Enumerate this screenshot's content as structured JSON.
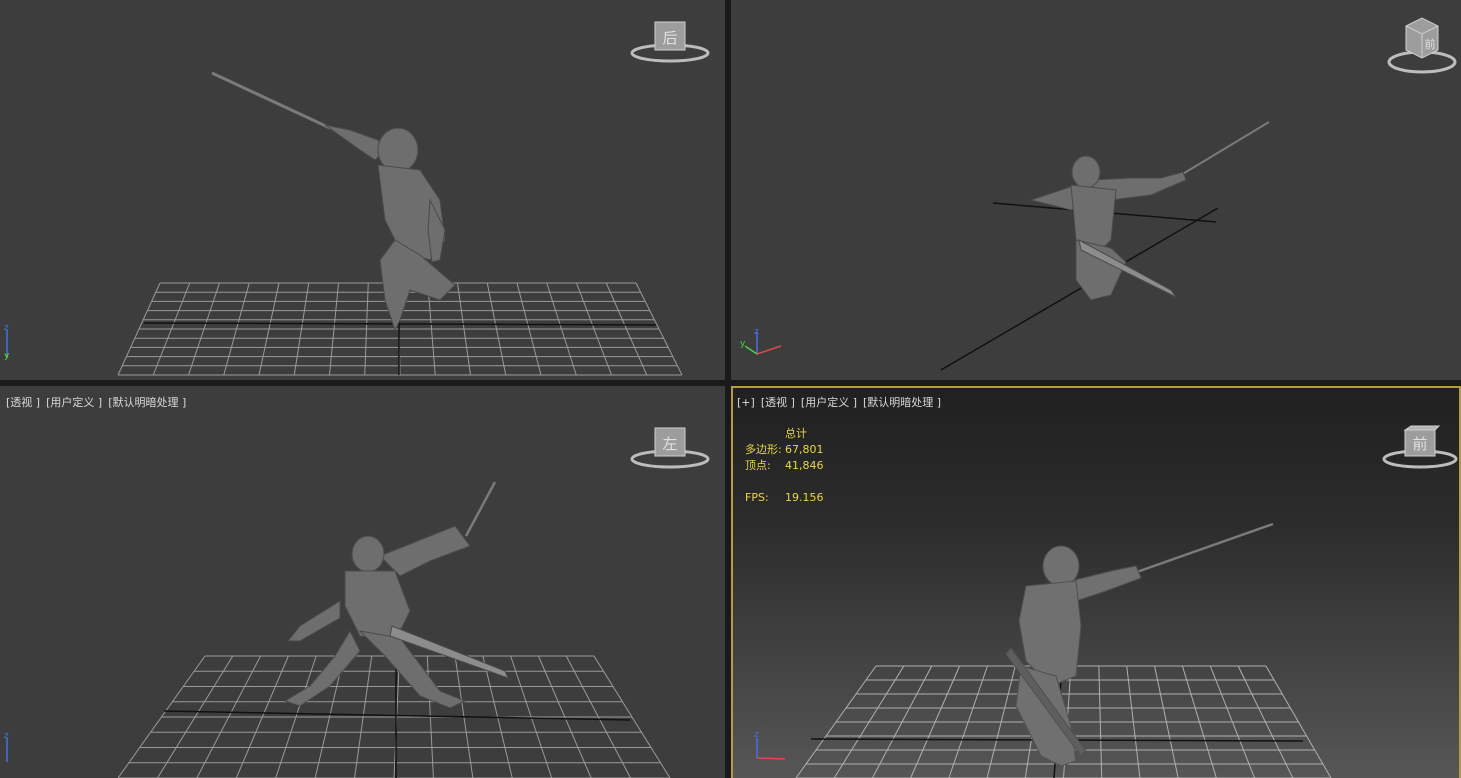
{
  "viewports": {
    "tl": {
      "label_items": [],
      "viewcube_face": "后"
    },
    "tr": {
      "label_items": [],
      "viewcube_face": "前"
    },
    "bl": {
      "label_items": [
        "[透视 ]",
        "[用户定义 ]",
        "[默认明暗处理 ]"
      ],
      "viewcube_face": "左"
    },
    "br": {
      "label_items": [
        "[+]",
        "[透视 ]",
        "[用户定义 ]",
        "[默认明暗处理 ]"
      ],
      "viewcube_face": "前"
    }
  },
  "stats": {
    "header": "总计",
    "polygons_label": "多边形:",
    "polygons_value": "67,801",
    "vertices_label": "顶点:",
    "vertices_value": "41,846",
    "fps_label": "FPS:",
    "fps_value": "19.156"
  },
  "axis_labels": {
    "x": "x",
    "y": "y",
    "z": "z"
  },
  "colors": {
    "active_border": "#b79a46",
    "stats_text": "#e8d64a",
    "grid": "#9a9a9a",
    "axis_line": "#000000",
    "model": "#6e6e6e"
  },
  "icons": {
    "viewcube": "viewcube-icon",
    "axis_tripod": "axis-tripod-icon"
  }
}
